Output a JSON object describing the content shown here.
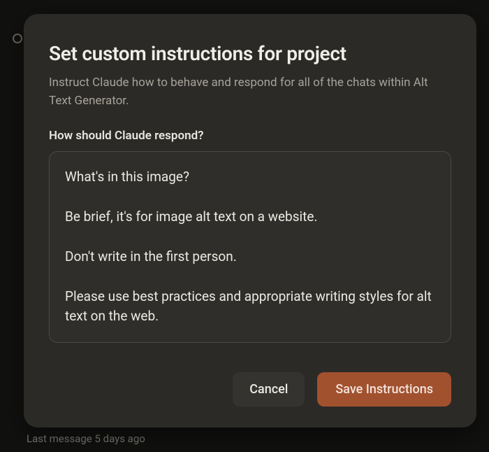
{
  "background": {
    "footer_text": "Last message 5 days ago"
  },
  "modal": {
    "title": "Set custom instructions for project",
    "subtitle": "Instruct Claude how to behave and respond for all of the chats within Alt Text Generator.",
    "field_label": "How should Claude respond?",
    "instructions_text": "What's in this image?\n\nBe brief, it's for image alt text on a website.\n\nDon't write in the first person.\n\nPlease use best practices and appropriate writing styles for alt text on the web.",
    "buttons": {
      "cancel": "Cancel",
      "save": "Save Instructions"
    }
  }
}
